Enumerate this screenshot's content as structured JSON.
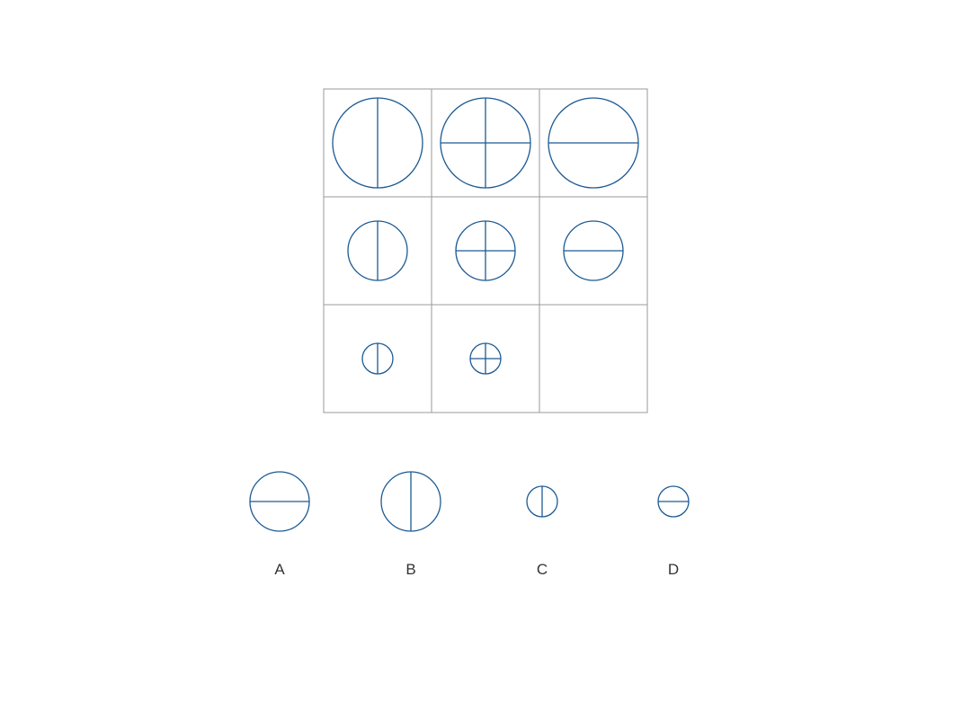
{
  "colors": {
    "figure_stroke": "#1c5a93",
    "grid_stroke": "#9a9a9a",
    "label_text": "#333333",
    "background": "#ffffff"
  },
  "puzzle": {
    "rows": 3,
    "cols": 3,
    "cells": [
      {
        "row": 1,
        "col": 1,
        "shape": "circle",
        "size": "large",
        "lines": [
          "vertical"
        ]
      },
      {
        "row": 1,
        "col": 2,
        "shape": "circle",
        "size": "large",
        "lines": [
          "vertical",
          "horizontal"
        ]
      },
      {
        "row": 1,
        "col": 3,
        "shape": "circle",
        "size": "large",
        "lines": [
          "horizontal"
        ]
      },
      {
        "row": 2,
        "col": 1,
        "shape": "circle",
        "size": "medium",
        "lines": [
          "vertical"
        ]
      },
      {
        "row": 2,
        "col": 2,
        "shape": "circle",
        "size": "medium",
        "lines": [
          "vertical",
          "horizontal"
        ]
      },
      {
        "row": 2,
        "col": 3,
        "shape": "circle",
        "size": "medium",
        "lines": [
          "horizontal"
        ]
      },
      {
        "row": 3,
        "col": 1,
        "shape": "circle",
        "size": "small",
        "lines": [
          "vertical"
        ]
      },
      {
        "row": 3,
        "col": 2,
        "shape": "circle",
        "size": "small",
        "lines": [
          "vertical",
          "horizontal"
        ]
      },
      {
        "row": 3,
        "col": 3,
        "shape": "empty"
      }
    ]
  },
  "options": [
    {
      "label": "A",
      "shape": "circle",
      "size": "medium",
      "lines": [
        "horizontal"
      ]
    },
    {
      "label": "B",
      "shape": "circle",
      "size": "medium",
      "lines": [
        "vertical"
      ]
    },
    {
      "label": "C",
      "shape": "circle",
      "size": "small",
      "lines": [
        "vertical"
      ]
    },
    {
      "label": "D",
      "shape": "circle",
      "size": "small",
      "lines": [
        "horizontal"
      ]
    }
  ]
}
